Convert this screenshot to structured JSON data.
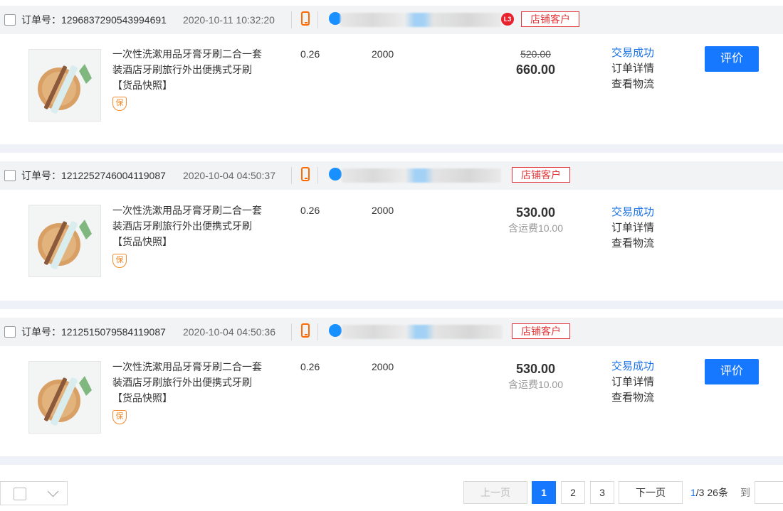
{
  "orders": [
    {
      "order_label": "订单号：",
      "order_no": "1296837290543994691",
      "time": "2020-10-11 10:32:20",
      "level": "L3",
      "shop_badge": "店铺客户",
      "product_title": "一次性洗漱用品牙膏牙刷二合一套装酒店牙刷旅行外出便携式牙刷 【货品快照】",
      "guarantee": "保",
      "unit_price": "0.26",
      "quantity": "2000",
      "original_price": "520.00",
      "total": "660.00",
      "shipping": "",
      "status": "交易成功",
      "detail_link": "订单详情",
      "logistics_link": "查看物流",
      "review_button": "评价"
    },
    {
      "order_label": "订单号：",
      "order_no": "1212252746004119087",
      "time": "2020-10-04 04:50:37",
      "level": "",
      "shop_badge": "店铺客户",
      "product_title": "一次性洗漱用品牙膏牙刷二合一套装酒店牙刷旅行外出便携式牙刷 【货品快照】",
      "guarantee": "保",
      "unit_price": "0.26",
      "quantity": "2000",
      "original_price": "",
      "total": "530.00",
      "shipping": "含运费10.00",
      "status": "交易成功",
      "detail_link": "订单详情",
      "logistics_link": "查看物流",
      "review_button": ""
    },
    {
      "order_label": "订单号：",
      "order_no": "1212515079584119087",
      "time": "2020-10-04 04:50:36",
      "level": "",
      "shop_badge": "店铺客户",
      "product_title": "一次性洗漱用品牙膏牙刷二合一套装酒店牙刷旅行外出便携式牙刷 【货品快照】",
      "guarantee": "保",
      "unit_price": "0.26",
      "quantity": "2000",
      "original_price": "",
      "total": "530.00",
      "shipping": "含运费10.00",
      "status": "交易成功",
      "detail_link": "订单详情",
      "logistics_link": "查看物流",
      "review_button": "评价"
    }
  ],
  "pagination": {
    "prev": "上一页",
    "pages": [
      "1",
      "2",
      "3"
    ],
    "active_page": "1",
    "next": "下一页",
    "current": "1",
    "total_pages": "/3",
    "total_count": "26条",
    "goto_label": "到"
  },
  "colors": {
    "accent": "#1677ff",
    "status_blue": "#1a73e8",
    "badge_red": "#e4393c",
    "phone_orange": "#ff6a00"
  }
}
